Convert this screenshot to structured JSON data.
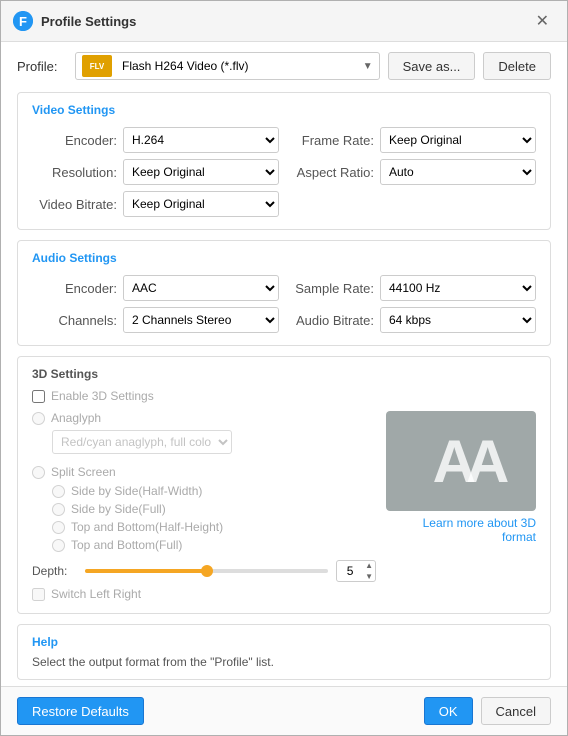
{
  "window": {
    "title": "Profile Settings",
    "icon_label": "F",
    "close_label": "✕"
  },
  "profile": {
    "label": "Profile:",
    "selected": "Flash H264 Video (*.flv)",
    "icon_text": "FLV",
    "save_as_label": "Save as...",
    "delete_label": "Delete"
  },
  "video_settings": {
    "title": "Video Settings",
    "encoder_label": "Encoder:",
    "encoder_value": "H.264",
    "resolution_label": "Resolution:",
    "resolution_value": "Keep Original",
    "bitrate_label": "Video Bitrate:",
    "bitrate_value": "Keep Original",
    "frame_rate_label": "Frame Rate:",
    "frame_rate_value": "Keep Original",
    "aspect_ratio_label": "Aspect Ratio:",
    "aspect_ratio_value": "Auto"
  },
  "audio_settings": {
    "title": "Audio Settings",
    "encoder_label": "Encoder:",
    "encoder_value": "AAC",
    "channels_label": "Channels:",
    "channels_value": "2 Channels Stereo",
    "sample_rate_label": "Sample Rate:",
    "sample_rate_value": "44100 Hz",
    "audio_bitrate_label": "Audio Bitrate:",
    "audio_bitrate_value": "64 kbps"
  },
  "settings_3d": {
    "title": "3D Settings",
    "enable_label": "Enable 3D Settings",
    "anaglyph_label": "Anaglyph",
    "anaglyph_select_value": "Red/cyan anaglyph, full color",
    "split_screen_label": "Split Screen",
    "side_by_side_half_label": "Side by Side(Half-Width)",
    "side_by_side_full_label": "Side by Side(Full)",
    "top_bottom_half_label": "Top and Bottom(Half-Height)",
    "top_bottom_full_label": "Top and Bottom(Full)",
    "depth_label": "Depth:",
    "depth_value": "5",
    "switch_label": "Switch Left Right",
    "learn_more_label": "Learn more about 3D format",
    "preview_text": "AA"
  },
  "help": {
    "title": "Help",
    "text": "Select the output format from the \"Profile\" list."
  },
  "footer": {
    "restore_label": "Restore Defaults",
    "ok_label": "OK",
    "cancel_label": "Cancel"
  }
}
